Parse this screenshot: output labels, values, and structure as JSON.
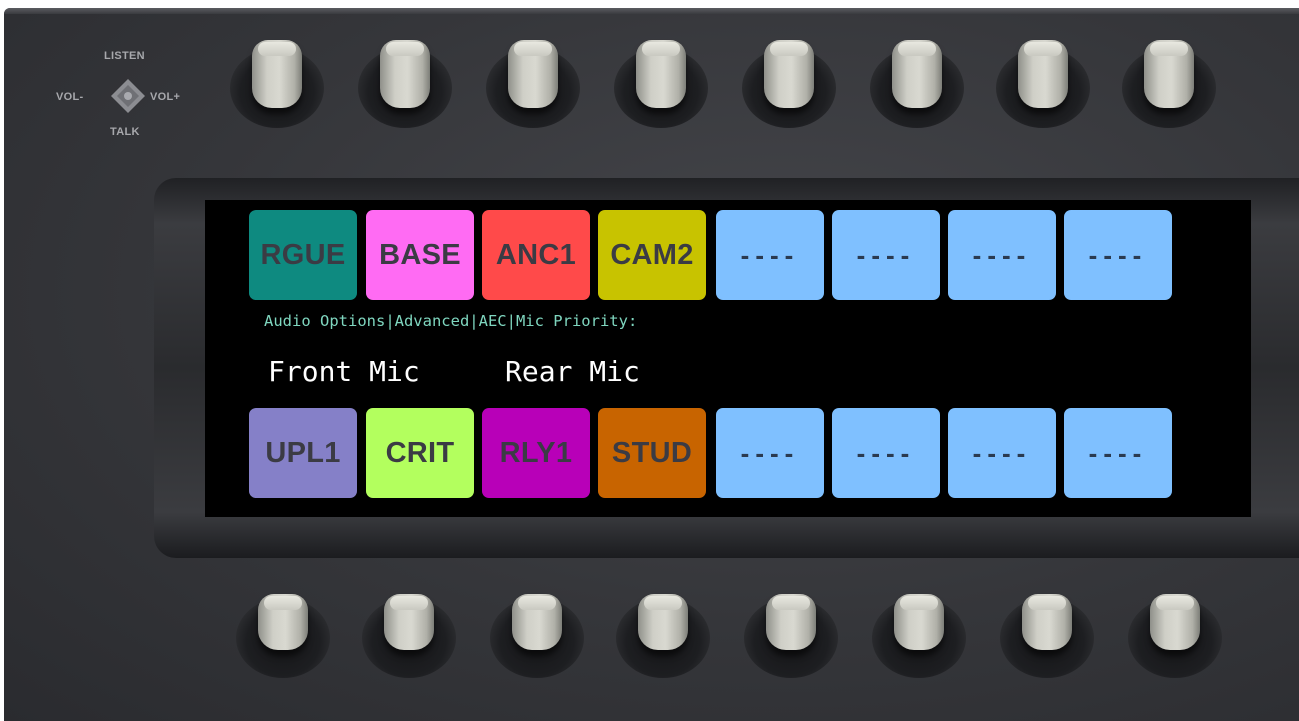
{
  "nav_pad": {
    "listen_label": "LISTEN",
    "talk_label": "TALK",
    "vol_down_label": "VOL-",
    "vol_up_label": "VOL+"
  },
  "display": {
    "top_row": [
      {
        "label": "RGUE",
        "color": "#0e8a80"
      },
      {
        "label": "BASE",
        "color": "#ff6bf3"
      },
      {
        "label": "ANC1",
        "color": "#ff4a4a"
      },
      {
        "label": "CAM2",
        "color": "#c8c300"
      },
      {
        "label": "----",
        "color": "#7fc0ff"
      },
      {
        "label": "----",
        "color": "#7fc0ff"
      },
      {
        "label": "----",
        "color": "#7fc0ff"
      },
      {
        "label": "----",
        "color": "#7fc0ff"
      }
    ],
    "menu_path": "Audio Options|Advanced|AEC|Mic Priority:",
    "option_front": "Front Mic",
    "option_rear": "Rear Mic",
    "bottom_row": [
      {
        "label": "UPL1",
        "color": "#8580c8"
      },
      {
        "label": "CRIT",
        "color": "#b3ff5e"
      },
      {
        "label": "RLY1",
        "color": "#b800b8"
      },
      {
        "label": "STUD",
        "color": "#c86400"
      },
      {
        "label": "----",
        "color": "#7fc0ff"
      },
      {
        "label": "----",
        "color": "#7fc0ff"
      },
      {
        "label": "----",
        "color": "#7fc0ff"
      },
      {
        "label": "----",
        "color": "#7fc0ff"
      }
    ]
  }
}
